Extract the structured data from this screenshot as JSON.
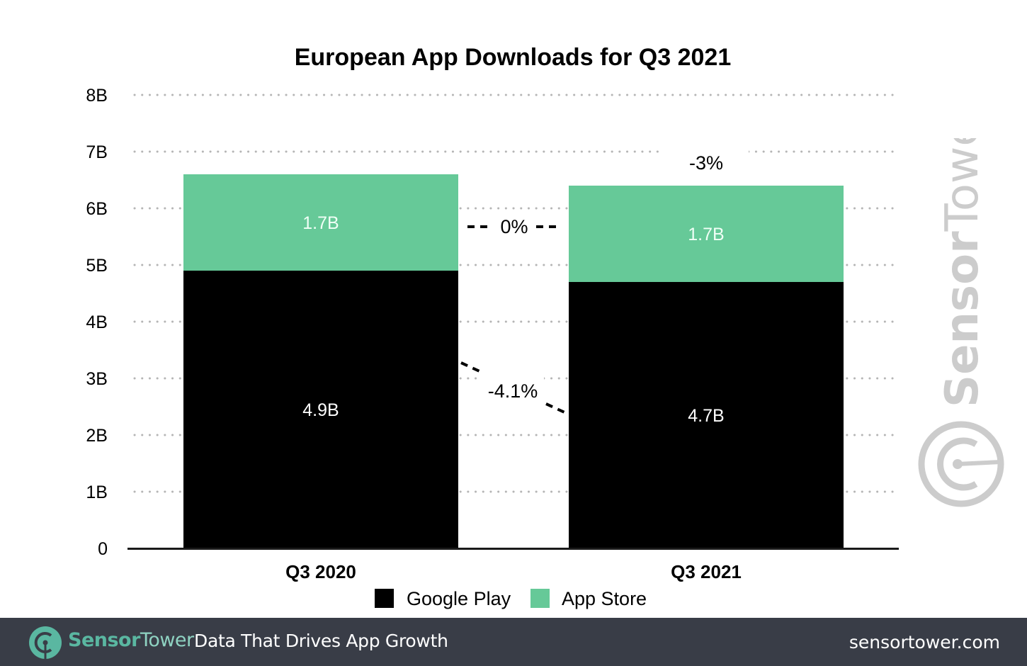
{
  "chart_data": {
    "type": "bar",
    "stacked": true,
    "title": "European App Downloads for Q3 2021",
    "xlabel": "",
    "ylabel": "",
    "categories": [
      "Q3 2020",
      "Q3 2021"
    ],
    "series": [
      {
        "name": "Google Play",
        "color": "#000000",
        "values": [
          4.9,
          4.7
        ],
        "labels": [
          "4.9B",
          "4.7B"
        ]
      },
      {
        "name": "App Store",
        "color": "#66c998",
        "values": [
          1.7,
          1.7
        ],
        "labels": [
          "1.7B",
          "1.7B"
        ]
      }
    ],
    "ylim": [
      0,
      8
    ],
    "yticks": [
      0,
      1,
      2,
      3,
      4,
      5,
      6,
      7,
      8
    ],
    "ytick_labels": [
      "0",
      "1B",
      "2B",
      "3B",
      "4B",
      "5B",
      "6B",
      "7B",
      "8B"
    ],
    "grid": true,
    "grid_style": "dotted",
    "legend": {
      "position": "bottom-center",
      "entries": [
        "Google Play",
        "App Store"
      ]
    },
    "annotations": [
      {
        "text": "-3%",
        "meaning": "total change",
        "anchor": "above Q3 2021 bar"
      },
      {
        "text": "0%",
        "meaning": "App Store change",
        "anchor": "between bars, App Store segment"
      },
      {
        "text": "-4.1%",
        "meaning": "Google Play change",
        "anchor": "between bars, Google Play segment"
      }
    ]
  },
  "watermark": {
    "text_bold": "Sensor",
    "text_light": "Tower"
  },
  "footer": {
    "brand_bold": "Sensor",
    "brand_light": "Tower",
    "tagline": "Data That Drives App Growth",
    "site": "sensortower.com",
    "background_color": "#393d47",
    "brand_color": "#5ab7a1"
  }
}
